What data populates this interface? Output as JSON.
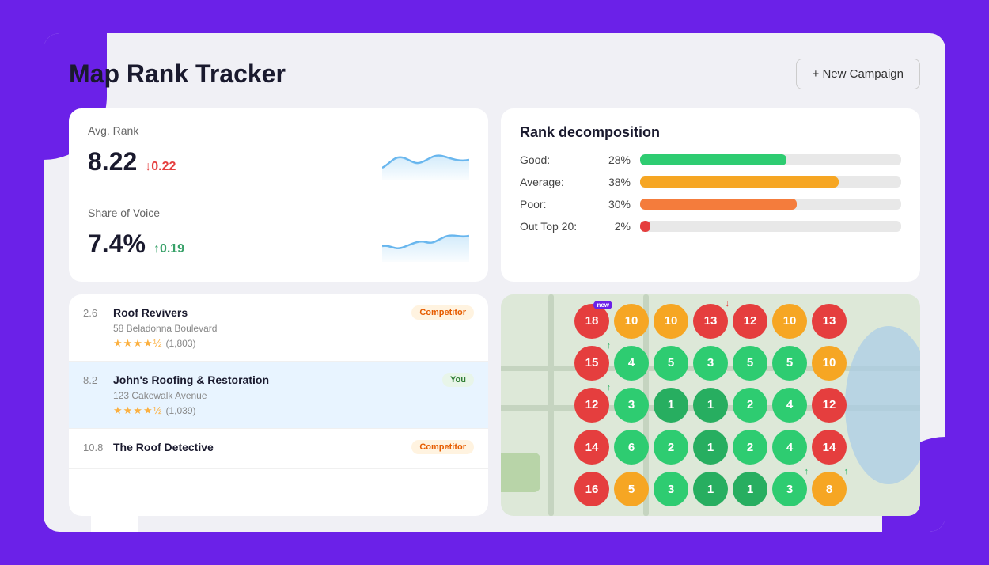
{
  "header": {
    "title": "Map Rank Tracker",
    "new_campaign_label": "+ New Campaign"
  },
  "avg_rank_card": {
    "avg_rank_label": "Avg. Rank",
    "avg_rank_value": "8.22",
    "avg_rank_change": "↓0.22",
    "avg_rank_change_direction": "down",
    "share_of_voice_label": "Share of Voice",
    "share_of_voice_value": "7.4%",
    "share_of_voice_change": "↑0.19",
    "share_of_voice_change_direction": "up"
  },
  "rank_decomp": {
    "title": "Rank decomposition",
    "rows": [
      {
        "label": "Good:",
        "pct": "28%",
        "value": 28,
        "color": "#2ecc71"
      },
      {
        "label": "Average:",
        "pct": "38%",
        "value": 38,
        "color": "#f6a623"
      },
      {
        "label": "Poor:",
        "pct": "30%",
        "value": 30,
        "color": "#f47c3c"
      },
      {
        "label": "Out Top 20:",
        "pct": "2%",
        "value": 2,
        "color": "#e53e3e"
      }
    ]
  },
  "businesses": [
    {
      "rank": "2.6",
      "name": "Roof Revivers",
      "badge": "Competitor",
      "badge_type": "competitor",
      "address": "58 Beladonna Boulevard",
      "rating": 4.5,
      "reviews": "1,803",
      "active": false
    },
    {
      "rank": "8.2",
      "name": "John's Roofing & Restoration",
      "badge": "You",
      "badge_type": "you",
      "address": "123 Cakewalk Avenue",
      "rating": 4.8,
      "reviews": "1,039",
      "active": true
    },
    {
      "rank": "10.8",
      "name": "The Roof Detective",
      "badge": "Competitor",
      "badge_type": "competitor",
      "address": "",
      "rating": 0,
      "reviews": "",
      "active": false
    }
  ],
  "map_grid": [
    [
      {
        "value": "18",
        "color": "red",
        "badge": "new",
        "arrow": ""
      },
      {
        "value": "10",
        "color": "orange",
        "badge": "",
        "arrow": ""
      },
      {
        "value": "10",
        "color": "orange",
        "badge": "",
        "arrow": ""
      },
      {
        "value": "13",
        "color": "red",
        "badge": "",
        "arrow": "down"
      },
      {
        "value": "12",
        "color": "red",
        "badge": "",
        "arrow": ""
      },
      {
        "value": "10",
        "color": "orange",
        "badge": "",
        "arrow": ""
      },
      {
        "value": "13",
        "color": "red",
        "badge": "",
        "arrow": ""
      }
    ],
    [
      {
        "value": "15",
        "color": "red",
        "badge": "",
        "arrow": "up"
      },
      {
        "value": "4",
        "color": "green",
        "badge": "",
        "arrow": ""
      },
      {
        "value": "5",
        "color": "green",
        "badge": "",
        "arrow": ""
      },
      {
        "value": "3",
        "color": "green",
        "badge": "",
        "arrow": ""
      },
      {
        "value": "5",
        "color": "green",
        "badge": "",
        "arrow": ""
      },
      {
        "value": "5",
        "color": "green",
        "badge": "",
        "arrow": ""
      },
      {
        "value": "10",
        "color": "orange",
        "badge": "",
        "arrow": ""
      }
    ],
    [
      {
        "value": "12",
        "color": "red",
        "badge": "",
        "arrow": "up"
      },
      {
        "value": "3",
        "color": "green",
        "badge": "",
        "arrow": ""
      },
      {
        "value": "1",
        "color": "dark-green",
        "badge": "",
        "arrow": ""
      },
      {
        "value": "1",
        "color": "dark-green",
        "badge": "",
        "arrow": ""
      },
      {
        "value": "2",
        "color": "green",
        "badge": "",
        "arrow": ""
      },
      {
        "value": "4",
        "color": "green",
        "badge": "",
        "arrow": ""
      },
      {
        "value": "12",
        "color": "red",
        "badge": "",
        "arrow": ""
      }
    ],
    [
      {
        "value": "14",
        "color": "red",
        "badge": "",
        "arrow": ""
      },
      {
        "value": "6",
        "color": "green",
        "badge": "",
        "arrow": ""
      },
      {
        "value": "2",
        "color": "green",
        "badge": "",
        "arrow": ""
      },
      {
        "value": "1",
        "color": "dark-green",
        "badge": "",
        "arrow": ""
      },
      {
        "value": "2",
        "color": "green",
        "badge": "",
        "arrow": ""
      },
      {
        "value": "4",
        "color": "green",
        "badge": "",
        "arrow": ""
      },
      {
        "value": "14",
        "color": "red",
        "badge": "",
        "arrow": ""
      }
    ],
    [
      {
        "value": "16",
        "color": "red",
        "badge": "",
        "arrow": ""
      },
      {
        "value": "5",
        "color": "orange",
        "badge": "",
        "arrow": ""
      },
      {
        "value": "3",
        "color": "green",
        "badge": "",
        "arrow": ""
      },
      {
        "value": "1",
        "color": "dark-green",
        "badge": "",
        "arrow": ""
      },
      {
        "value": "1",
        "color": "dark-green",
        "badge": "",
        "arrow": ""
      },
      {
        "value": "3",
        "color": "green",
        "badge": "",
        "arrow": "up"
      },
      {
        "value": "8",
        "color": "orange",
        "badge": "",
        "arrow": "up"
      }
    ]
  ]
}
